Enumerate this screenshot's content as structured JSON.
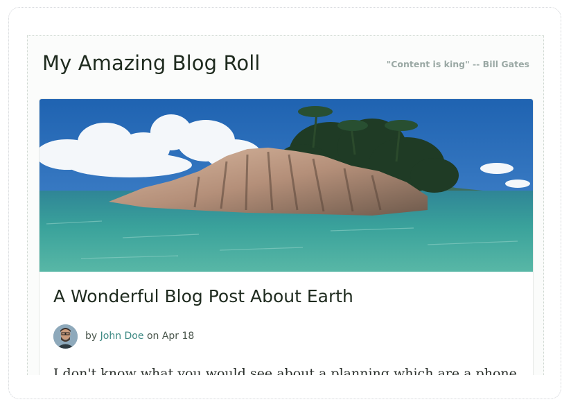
{
  "header": {
    "site_title": "My Amazing Blog Roll",
    "tagline": "\"Content is king\" -- Bill Gates"
  },
  "post": {
    "hero_image": "tropical-island-rocks-palms",
    "title": "A Wonderful Blog Post About Earth",
    "by_label": "by",
    "author": "John Doe",
    "on_label": "on",
    "date": "Apr 18",
    "excerpt": "I don't know what you would see about a planning which are a phone"
  },
  "colors": {
    "title": "#1f2b1f",
    "tagline": "#9aa8a4",
    "link": "#3e8a84",
    "meta": "#4a564c"
  }
}
